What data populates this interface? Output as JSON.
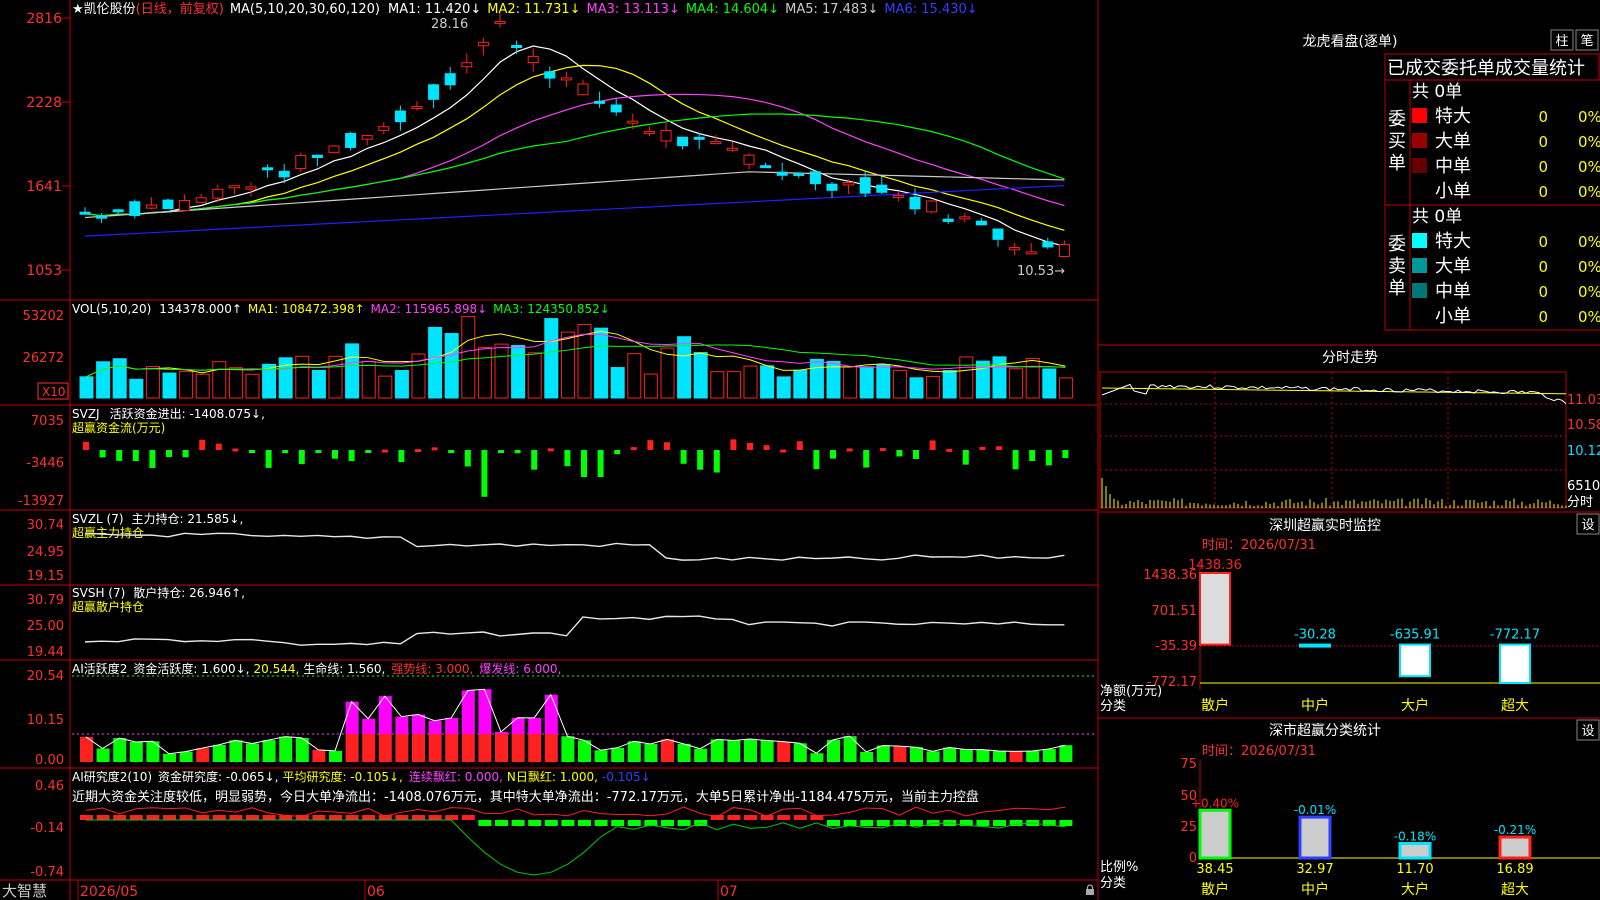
{
  "colors": {
    "up": "#ff2020",
    "down": "#00e5ff",
    "green": "#00ff00",
    "magenta": "#ff00ff",
    "yellow": "#ffff00",
    "white": "#e8e8e8",
    "blue": "#3040ff",
    "grid": "#c00000",
    "ma1": "#ffffff",
    "ma2": "#ffff00",
    "ma3": "#ff40ff",
    "ma4": "#00ff00",
    "ma5": "#cccccc",
    "ma6": "#2020ff",
    "textRed": "#ff3030"
  },
  "price": {
    "header": {
      "name": "★凯伦股份",
      "period": "(日线，前复权)",
      "ma_label": "MA(5,10,20,30,60,120)",
      "ma1": "MA1: 11.420↓",
      "ma2": "MA2: 11.731↓",
      "ma3": "MA3: 13.113↓",
      "ma4": "MA4: 14.604↓",
      "ma5": "MA5: 17.483↓",
      "ma6": "MA6: 15.430↓"
    },
    "yticks": [
      "2816",
      "2228",
      "1641",
      "1053"
    ],
    "yvals": [
      2816,
      2228,
      1641,
      1053
    ],
    "high_label": "28.16",
    "low_label": "10.53→",
    "star": "✱"
  },
  "vol": {
    "header": {
      "label": "VOL(5,10,20)",
      "value": "134378.000↑",
      "ma1": "MA1: 108472.398↑",
      "ma2": "MA2: 115965.898↓",
      "ma3": "MA3: 124350.852↓"
    },
    "yticks": [
      "53202",
      "26272"
    ],
    "unit": "X10"
  },
  "svzj": {
    "header": {
      "label": "SVZJ",
      "desc": "活跃资金进出: -1408.075↓,",
      "sub": "超赢资金流(万元)"
    },
    "yticks": [
      "7035",
      "-3446",
      "-13927"
    ]
  },
  "svzl": {
    "header": {
      "label": "SVZL (7)",
      "desc": "主力持仓: 21.585↓,",
      "sub": "超赢主力持仓"
    },
    "yticks": [
      "30.74",
      "24.95",
      "19.15"
    ]
  },
  "svsh": {
    "header": {
      "label": "SVSH (7)",
      "desc": "散户持仓: 26.946↑,",
      "sub": "超赢散户持仓"
    },
    "yticks": [
      "30.79",
      "25.00",
      "19.44"
    ]
  },
  "ai2": {
    "header": {
      "label": "AI活跃度2",
      "desc": "资金活跃度: 1.600↓,",
      "v2": "20.544,",
      "life": "生命线: 1.560,",
      "strong": "强势线: 3.000,",
      "burst": "爆发线: 6.000,"
    },
    "yticks": [
      "20.54",
      "10.15",
      "0.00"
    ]
  },
  "ai3": {
    "header": {
      "label": "AI研究度2(10)",
      "desc": "资金研究度: -0.065↓,",
      "avg": "平均研究度: -0.105↓,",
      "red": "连续飘红: 0.000,",
      "nred": "N日飘红: 1.000,",
      "last": "-0.105↓"
    },
    "comment": "近期大资金关注度较低，明显弱势，今日大单净流出：-1408.076万元，其中特大单净流出：-772.17万元，大单5日累计净出-1184.475万元，当前主力控盘",
    "yticks": [
      "0.46",
      "-0.14",
      "-0.74"
    ]
  },
  "xaxis": {
    "brand": "大智慧",
    "labels": [
      "2026/05",
      "06",
      "07"
    ]
  },
  "lhb": {
    "title": "龙虎看盘(逐单)",
    "btn1": "柱",
    "btn2": "笔",
    "tab_label": "已成交委托单成交量统计",
    "buy": {
      "side": "委买单",
      "total": "共 0单",
      "rows": [
        {
          "label": "特大",
          "count": "0",
          "pct": "0%",
          "color": "#ff0000"
        },
        {
          "label": "大单",
          "count": "0",
          "pct": "0%",
          "color": "#990000"
        },
        {
          "label": "中单",
          "count": "0",
          "pct": "0%",
          "color": "#660000"
        },
        {
          "label": "小单",
          "count": "0",
          "pct": "0%",
          "color": "#000000"
        }
      ]
    },
    "sell": {
      "side": "委卖单",
      "total": "共 0单",
      "rows": [
        {
          "label": "特大",
          "count": "0",
          "pct": "0%",
          "color": "#00ffff"
        },
        {
          "label": "大单",
          "count": "0",
          "pct": "0%",
          "color": "#009999"
        },
        {
          "label": "中单",
          "count": "0",
          "pct": "0%",
          "color": "#007777"
        },
        {
          "label": "小单",
          "count": "0",
          "pct": "0%",
          "color": "#000000"
        }
      ]
    }
  },
  "fenshi": {
    "title": "分时走势",
    "yticks": [
      "11.03",
      "10.58",
      "10.12"
    ],
    "vol_ticks": [
      "6510",
      "分时"
    ]
  },
  "szmon": {
    "title": "深圳超赢实时监控",
    "btn": "设",
    "time": "时间：2026/07/31",
    "yticks": [
      "1438.36",
      "701.51",
      "-35.39",
      "-772.17"
    ],
    "y_label": "净额(万元)",
    "x_label": "分类",
    "bars": [
      {
        "name": "散户",
        "value": 1438.36,
        "label": "1438.36"
      },
      {
        "name": "中户",
        "value": -30.28,
        "label": "-30.28"
      },
      {
        "name": "大户",
        "value": -635.91,
        "label": "-635.91"
      },
      {
        "name": "超大",
        "value": -772.17,
        "label": "-772.17"
      }
    ]
  },
  "szstat": {
    "title": "深市超赢分类统计",
    "btn": "设",
    "time": "时间：2026/07/31",
    "yticks": [
      "75",
      "50",
      "25",
      "0"
    ],
    "y_label": "比例%",
    "x_label": "分类",
    "bars": [
      {
        "name": "散户",
        "value": 38.45,
        "label": "38.45",
        "change": "+0.40%"
      },
      {
        "name": "中户",
        "value": 32.97,
        "label": "32.97",
        "change": "-0.01%"
      },
      {
        "name": "大户",
        "value": 11.7,
        "label": "11.70",
        "change": "-0.18%"
      },
      {
        "name": "超大",
        "value": 16.89,
        "label": "16.89",
        "change": "-0.21%"
      }
    ]
  }
}
